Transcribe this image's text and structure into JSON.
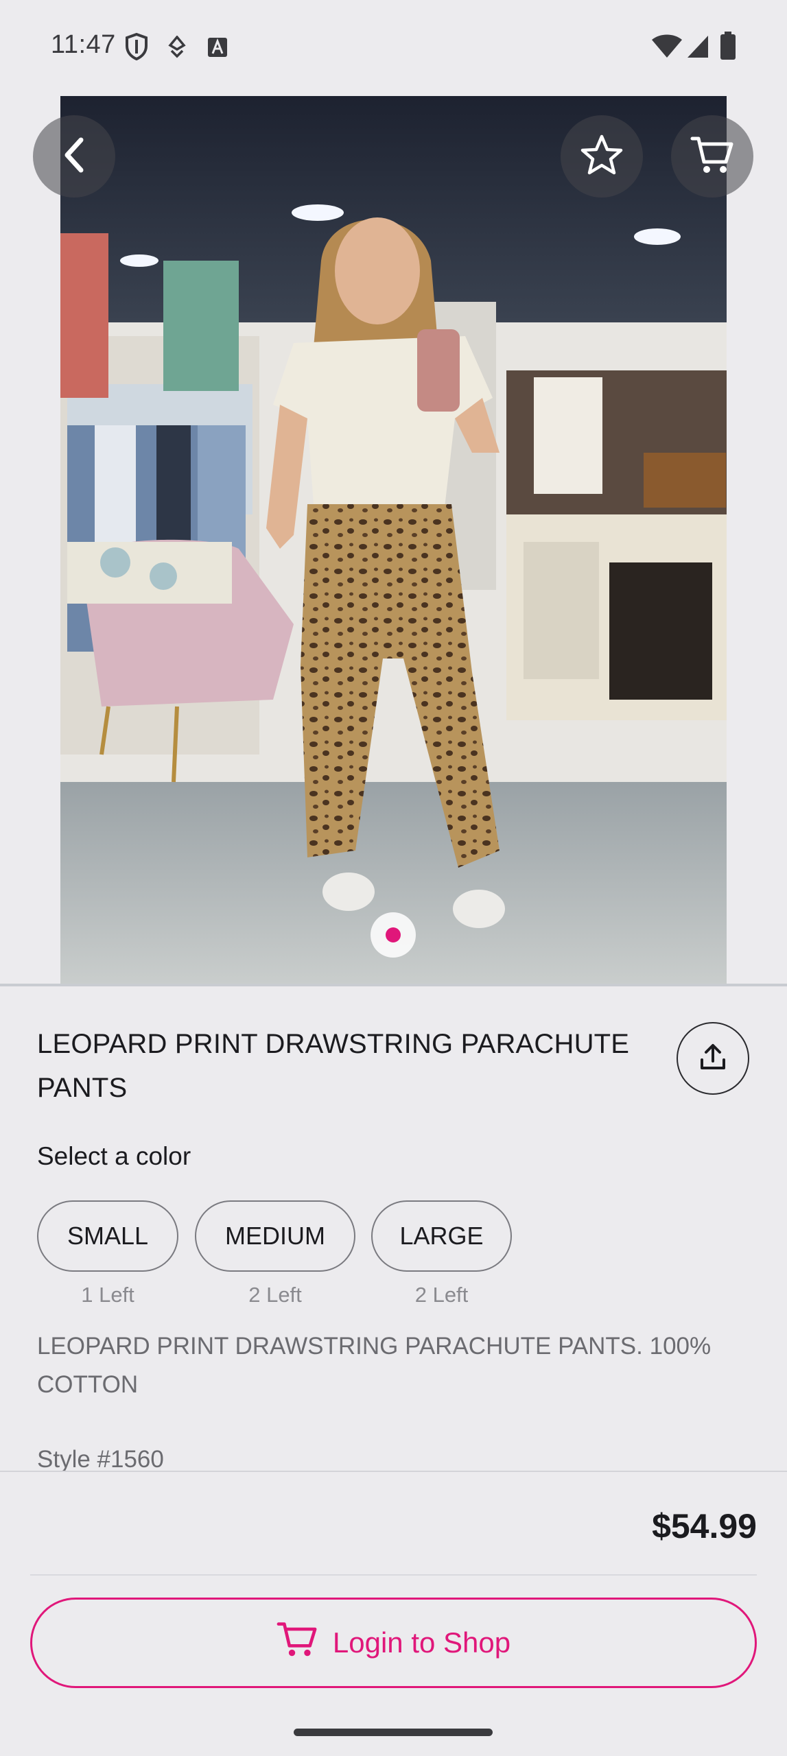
{
  "status_bar": {
    "time": "11:47",
    "icons": [
      "shield-icon",
      "location-icon",
      "a-icon",
      "wifi-icon",
      "signal-icon",
      "battery-icon"
    ]
  },
  "header": {
    "back_icon": "chevron-left-icon",
    "favorite_icon": "star-icon",
    "cart_icon": "cart-icon"
  },
  "gallery": {
    "image_alt": "Woman in leopard print pants taking a mirror selfie in a boutique",
    "pages": 1,
    "active_page": 1
  },
  "product": {
    "title": "LEOPARD PRINT DRAWSTRING PARACHUTE PANTS",
    "share_icon": "share-icon",
    "select_label": "Select a color",
    "sizes": [
      {
        "label": "SMALL",
        "stock": "1 Left"
      },
      {
        "label": "MEDIUM",
        "stock": "2 Left"
      },
      {
        "label": "LARGE",
        "stock": "2 Left"
      }
    ],
    "description": "LEOPARD PRINT DRAWSTRING PARACHUTE PANTS. 100% COTTON",
    "style_number": "Style #1560"
  },
  "footer": {
    "price": "$54.99",
    "login_label": "Login to Shop",
    "login_icon": "cart-icon"
  },
  "colors": {
    "accent": "#E0177A",
    "background": "#ECEBEE"
  }
}
